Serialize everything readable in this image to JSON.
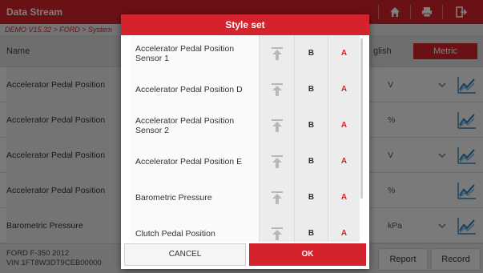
{
  "app": {
    "title": "Data Stream",
    "breadcrumb": "DEMO V15.32 > FORD > System",
    "toolbar_icons": [
      "home-icon",
      "print-icon",
      "exit-icon"
    ]
  },
  "table": {
    "name_header": "Name",
    "units": {
      "english": "glish",
      "metric": "Metric"
    },
    "rows": [
      {
        "name": "Accelerator Pedal Position",
        "unit": "V",
        "dropdown": true
      },
      {
        "name": "Accelerator Pedal Position",
        "unit": "%",
        "dropdown": false
      },
      {
        "name": "Accelerator Pedal Position",
        "unit": "V",
        "dropdown": true
      },
      {
        "name": "Accelerator Pedal Position",
        "unit": "%",
        "dropdown": false
      },
      {
        "name": "Barometric Pressure",
        "unit": "kPa",
        "dropdown": true
      }
    ]
  },
  "footer": {
    "vehicle_line1": "FORD F-350 2012",
    "vehicle_line2": "VIN 1FT8W3DT9CEB00000",
    "buttons": [
      "Report",
      "Record"
    ]
  },
  "dialog": {
    "title": "Style set",
    "items": [
      {
        "label": "Accelerator Pedal Position Sensor 1",
        "b": "B",
        "a": "A"
      },
      {
        "label": "Accelerator Pedal Position D",
        "b": "B",
        "a": "A"
      },
      {
        "label": "Accelerator Pedal Position Sensor 2",
        "b": "B",
        "a": "A"
      },
      {
        "label": "Accelerator Pedal Position E",
        "b": "B",
        "a": "A"
      },
      {
        "label": "Barometric Pressure",
        "b": "B",
        "a": "A"
      },
      {
        "label": "Clutch Pedal Position",
        "b": "B",
        "a": "A"
      }
    ],
    "cancel_label": "CANCEL",
    "ok_label": "OK"
  },
  "colors": {
    "brand_red": "#d4232c",
    "graph_blue": "#2e86c1"
  }
}
